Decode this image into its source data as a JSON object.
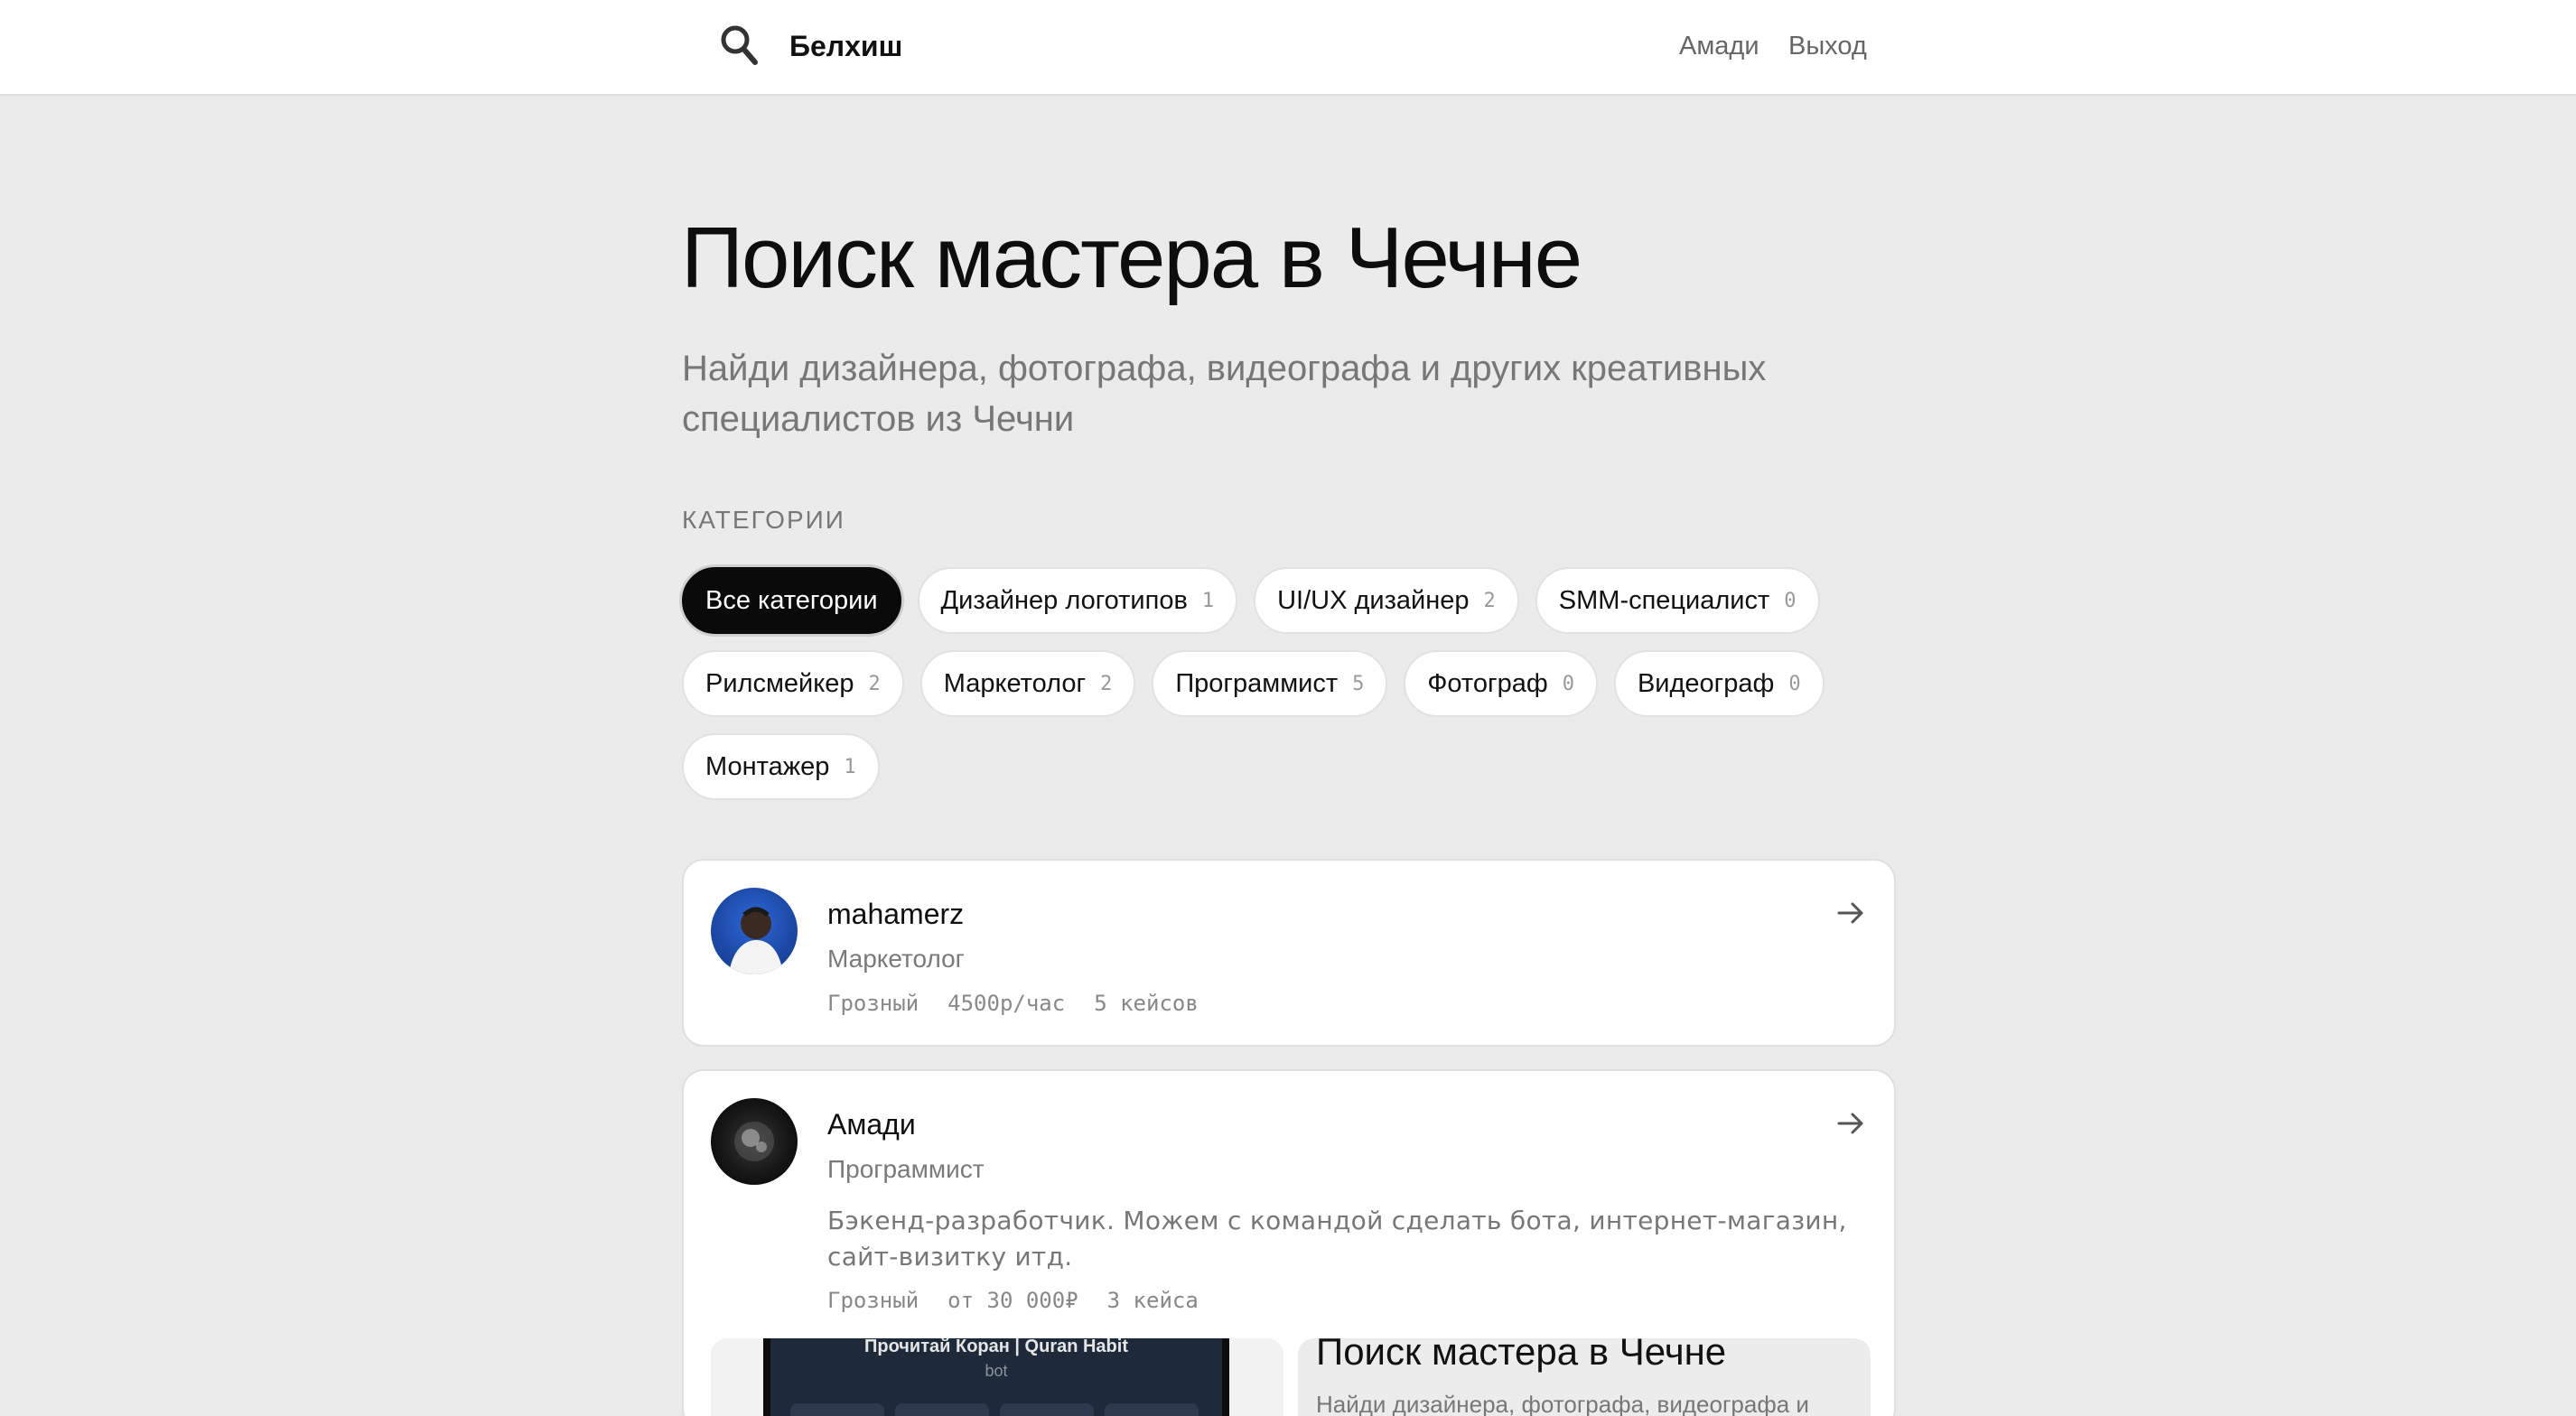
{
  "header": {
    "brand": "Белхиш",
    "nav": {
      "user": "Амади",
      "logout": "Выход"
    },
    "icon": "search-icon"
  },
  "hero": {
    "title": "Поиск мастера в Чечне",
    "subtitle": "Найди дизайнера, фотографа, видеографа и других креативных специалистов из Чечни"
  },
  "categories": {
    "heading": "КАТЕГОРИИ",
    "items": [
      {
        "label": "Все категории",
        "count": "",
        "active": true
      },
      {
        "label": "Дизайнер логотипов",
        "count": "1"
      },
      {
        "label": "UI/UX дизайнер",
        "count": "2"
      },
      {
        "label": "SMM-специалист",
        "count": "0"
      },
      {
        "label": "Рилсмейкер",
        "count": "2"
      },
      {
        "label": "Маркетолог",
        "count": "2"
      },
      {
        "label": "Программист",
        "count": "5"
      },
      {
        "label": "Фотограф",
        "count": "0"
      },
      {
        "label": "Видеограф",
        "count": "0"
      },
      {
        "label": "Монтажер",
        "count": "1"
      }
    ]
  },
  "specialists": [
    {
      "name": "mahamerz",
      "role": "Маркетолог",
      "city": "Грозный",
      "price": "4500р/час",
      "cases": "5 кейсов"
    },
    {
      "name": "Амади",
      "role": "Программист",
      "description": "Бэкенд-разработчик. Можем с командой сделать бота, интернет-магазин, сайт-визитку итд.",
      "city": "Грозный",
      "price": "от 30 000₽",
      "cases": "3 кейса",
      "previews": [
        {
          "title": "Прочитай Коран | Quran Habit",
          "subtitle": "bot"
        },
        {
          "title": "Поиск мастера в Чечне",
          "subtitle": "Найди дизайнера, фотографа, видеографа и"
        }
      ]
    }
  ],
  "colors": {
    "page_bg": "#ebebeb",
    "header_bg": "#ffffff",
    "accent": "#0a0a0a",
    "muted_text": "#777777"
  }
}
